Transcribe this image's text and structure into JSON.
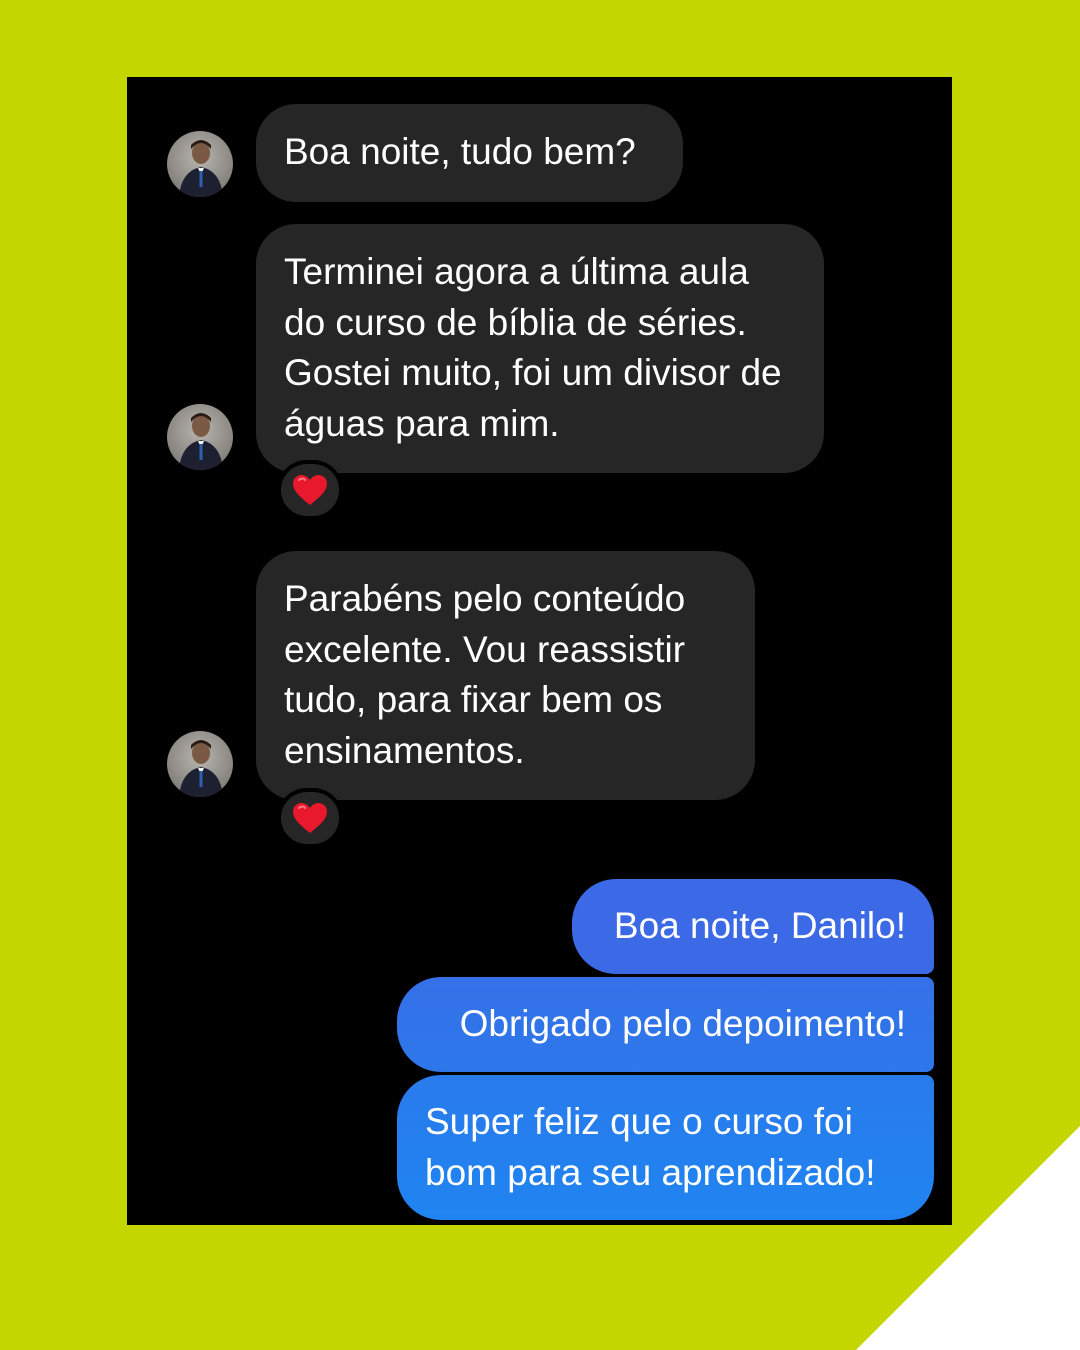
{
  "colors": {
    "background": "#c3d600",
    "screen": "#000000",
    "incoming_bubble": "#262626",
    "outgoing_gradient_top": "#3d6be8",
    "outgoing_gradient_bottom": "#1f83f0",
    "reaction_heart": "#e8192c"
  },
  "conversation": {
    "incoming": [
      {
        "text": "Boa noite, tudo bem?",
        "reaction": null
      },
      {
        "text": "Terminei agora a última aula do curso de bíblia de séries. Gostei muito, foi um divisor de águas para mim.",
        "reaction": "heart-icon"
      },
      {
        "text": "Parabéns pelo conteúdo excelente. Vou reassistir tudo, para fixar bem os ensinamentos.",
        "reaction": "heart-icon"
      }
    ],
    "outgoing": [
      {
        "text": "Boa noite, Danilo!"
      },
      {
        "text": "Obrigado pelo depoimento!"
      },
      {
        "text": "Super feliz que o curso foi bom para seu aprendizado!"
      }
    ]
  }
}
